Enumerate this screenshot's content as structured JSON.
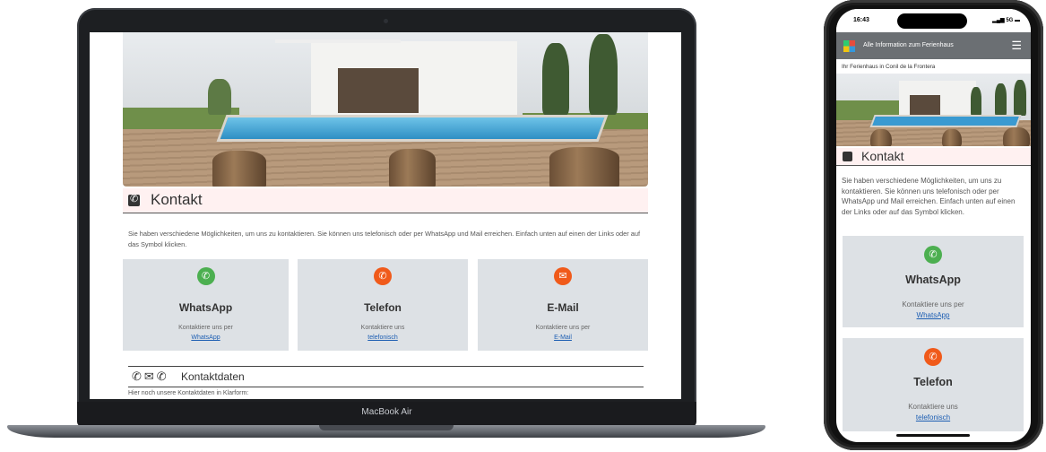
{
  "laptop": {
    "brand": "MacBook Air",
    "kontakt_title": "Kontakt",
    "intro": "Sie haben verschiedene Möglichkeiten, um uns zu kontaktieren. Sie können uns telefonisch oder per WhatsApp und Mail erreichen. Einfach unten auf einen der Links oder auf das Symbol klicken.",
    "cards": [
      {
        "title": "WhatsApp",
        "text": "Kontaktiere uns per",
        "link": "WhatsApp",
        "icon": "whatsapp-icon",
        "color": "#4caf50"
      },
      {
        "title": "Telefon",
        "text": "Kontaktiere uns",
        "link": "telefonisch",
        "icon": "phone-icon",
        "color": "#f05a1a"
      },
      {
        "title": "E-Mail",
        "text": "Kontaktiere uns per",
        "link": "E-Mail",
        "icon": "mail-icon",
        "color": "#f05a1a"
      }
    ],
    "kontaktdaten_title": "Kontaktdaten",
    "kontaktdaten_text": "Hier noch unsere Kontaktdaten in Klarform:"
  },
  "phone": {
    "time": "16:43",
    "signal": "5G",
    "nav_title": "Alle Information zum Ferienhaus",
    "subtitle": "Ihr Ferienhaus in Conil de la Frontera",
    "kontakt_title": "Kontakt",
    "intro": "Sie haben verschiedene Möglichkeiten, um uns zu kontaktieren. Sie können uns telefonisch oder per WhatsApp und Mail erreichen. Einfach unten auf einen der Links oder auf das Symbol klicken.",
    "cards": [
      {
        "title": "WhatsApp",
        "text": "Kontaktiere uns per",
        "link": "WhatsApp",
        "icon": "whatsapp-icon",
        "color": "#4caf50"
      },
      {
        "title": "Telefon",
        "text": "Kontaktiere uns",
        "link": "telefonisch",
        "icon": "phone-icon",
        "color": "#f05a1a"
      }
    ]
  }
}
